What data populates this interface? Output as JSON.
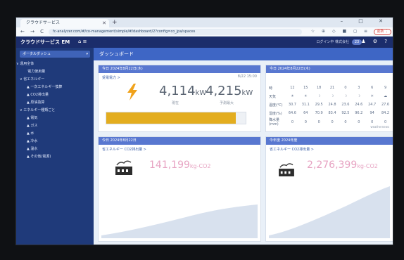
{
  "browser": {
    "tab_title": "クラウドサービス",
    "new_tab": "+",
    "window_controls": "– □ ✕",
    "nav": "← → C ⌂",
    "url": "fc-analyzer.com/#/co-management/simple/#/dashboard/2?config=co_jpa/spaces",
    "extensions": "☆ ⊕ ◇ ■ ◻ ≡",
    "update_label": "更新 ⋮"
  },
  "app": {
    "title": "クラウドサービス EM",
    "header_icons": "⌂ ≡",
    "user": "ログイン中 株式会社",
    "pill": "23",
    "right_icons": "♟ ⚙ ?"
  },
  "sidebar": {
    "selector_label": "ポータルダッシュ",
    "selector_caret": "▾",
    "items": [
      {
        "label": "∨ 運用全体"
      },
      {
        "label": "　　ㅤ 電力使用量"
      },
      {
        "label": "　∨ 省エネルギー"
      },
      {
        "label": "　　　▲ 一次エネルギー換算"
      },
      {
        "label": "　　　▲ CO2排出量"
      },
      {
        "label": "　　　▲ 原油換算"
      },
      {
        "label": "　∨ エネルギー種類ごと"
      },
      {
        "label": "　　　▲ 電気"
      },
      {
        "label": "　　　▲ ガス"
      },
      {
        "label": "　　　▲ 水"
      },
      {
        "label": "　　　▲ 冷水"
      },
      {
        "label": "　　　▲ 温水"
      },
      {
        "label": "　　　▲ その他(電源)"
      }
    ]
  },
  "main": {
    "title": "ダッシュボード",
    "power": {
      "head": "今日 2024年8月22日(木)",
      "sub": "受電電力 >",
      "time": "8/22 15:00",
      "value1": "4,114",
      "unit1": "kW",
      "cap1": "現在",
      "value2": "4,215",
      "unit2": "kW",
      "cap2": "予測最大",
      "progress": 0.93
    },
    "weather": {
      "head": "今日 2024年8月22日(木)",
      "hours": [
        "時",
        "12",
        "15",
        "18",
        "21",
        "0",
        "3",
        "6",
        "9"
      ],
      "icon_row_label": "天気",
      "icons": [
        "sun",
        "sun",
        "moon",
        "moon",
        "moon",
        "moon",
        "sun",
        "cloud"
      ],
      "temp_label": "温度(℃)",
      "temps": [
        "30.7",
        "31.1",
        "29.5",
        "24.8",
        "23.6",
        "24.6",
        "24.7",
        "27.6"
      ],
      "hum_label": "湿度(%)",
      "hums": [
        "64.6",
        "64",
        "70.9",
        "83.4",
        "92.5",
        "96.2",
        "94",
        "84.2"
      ],
      "rain_label": "降水量(mm)",
      "rains": [
        "0",
        "0",
        "0",
        "0",
        "0",
        "0",
        "0",
        "0"
      ],
      "foot": "weathernews"
    },
    "co2_today": {
      "head": "今日 2024年8月22日",
      "sub": "省エネルギー CO2排出量 >",
      "value": "141,199",
      "unit": "kg-CO2"
    },
    "co2_year": {
      "head": "今年度 2024年度",
      "sub": "省エネルギー CO2排出量 >",
      "value": "2,276,399",
      "unit": "kg-CO2"
    }
  },
  "colors": {
    "sidebar": "#1f3a7a",
    "header": "#1b2d6b",
    "card_head": "#5877d0",
    "progress": "#e3ad1f",
    "co2": "#e7a4c3"
  }
}
